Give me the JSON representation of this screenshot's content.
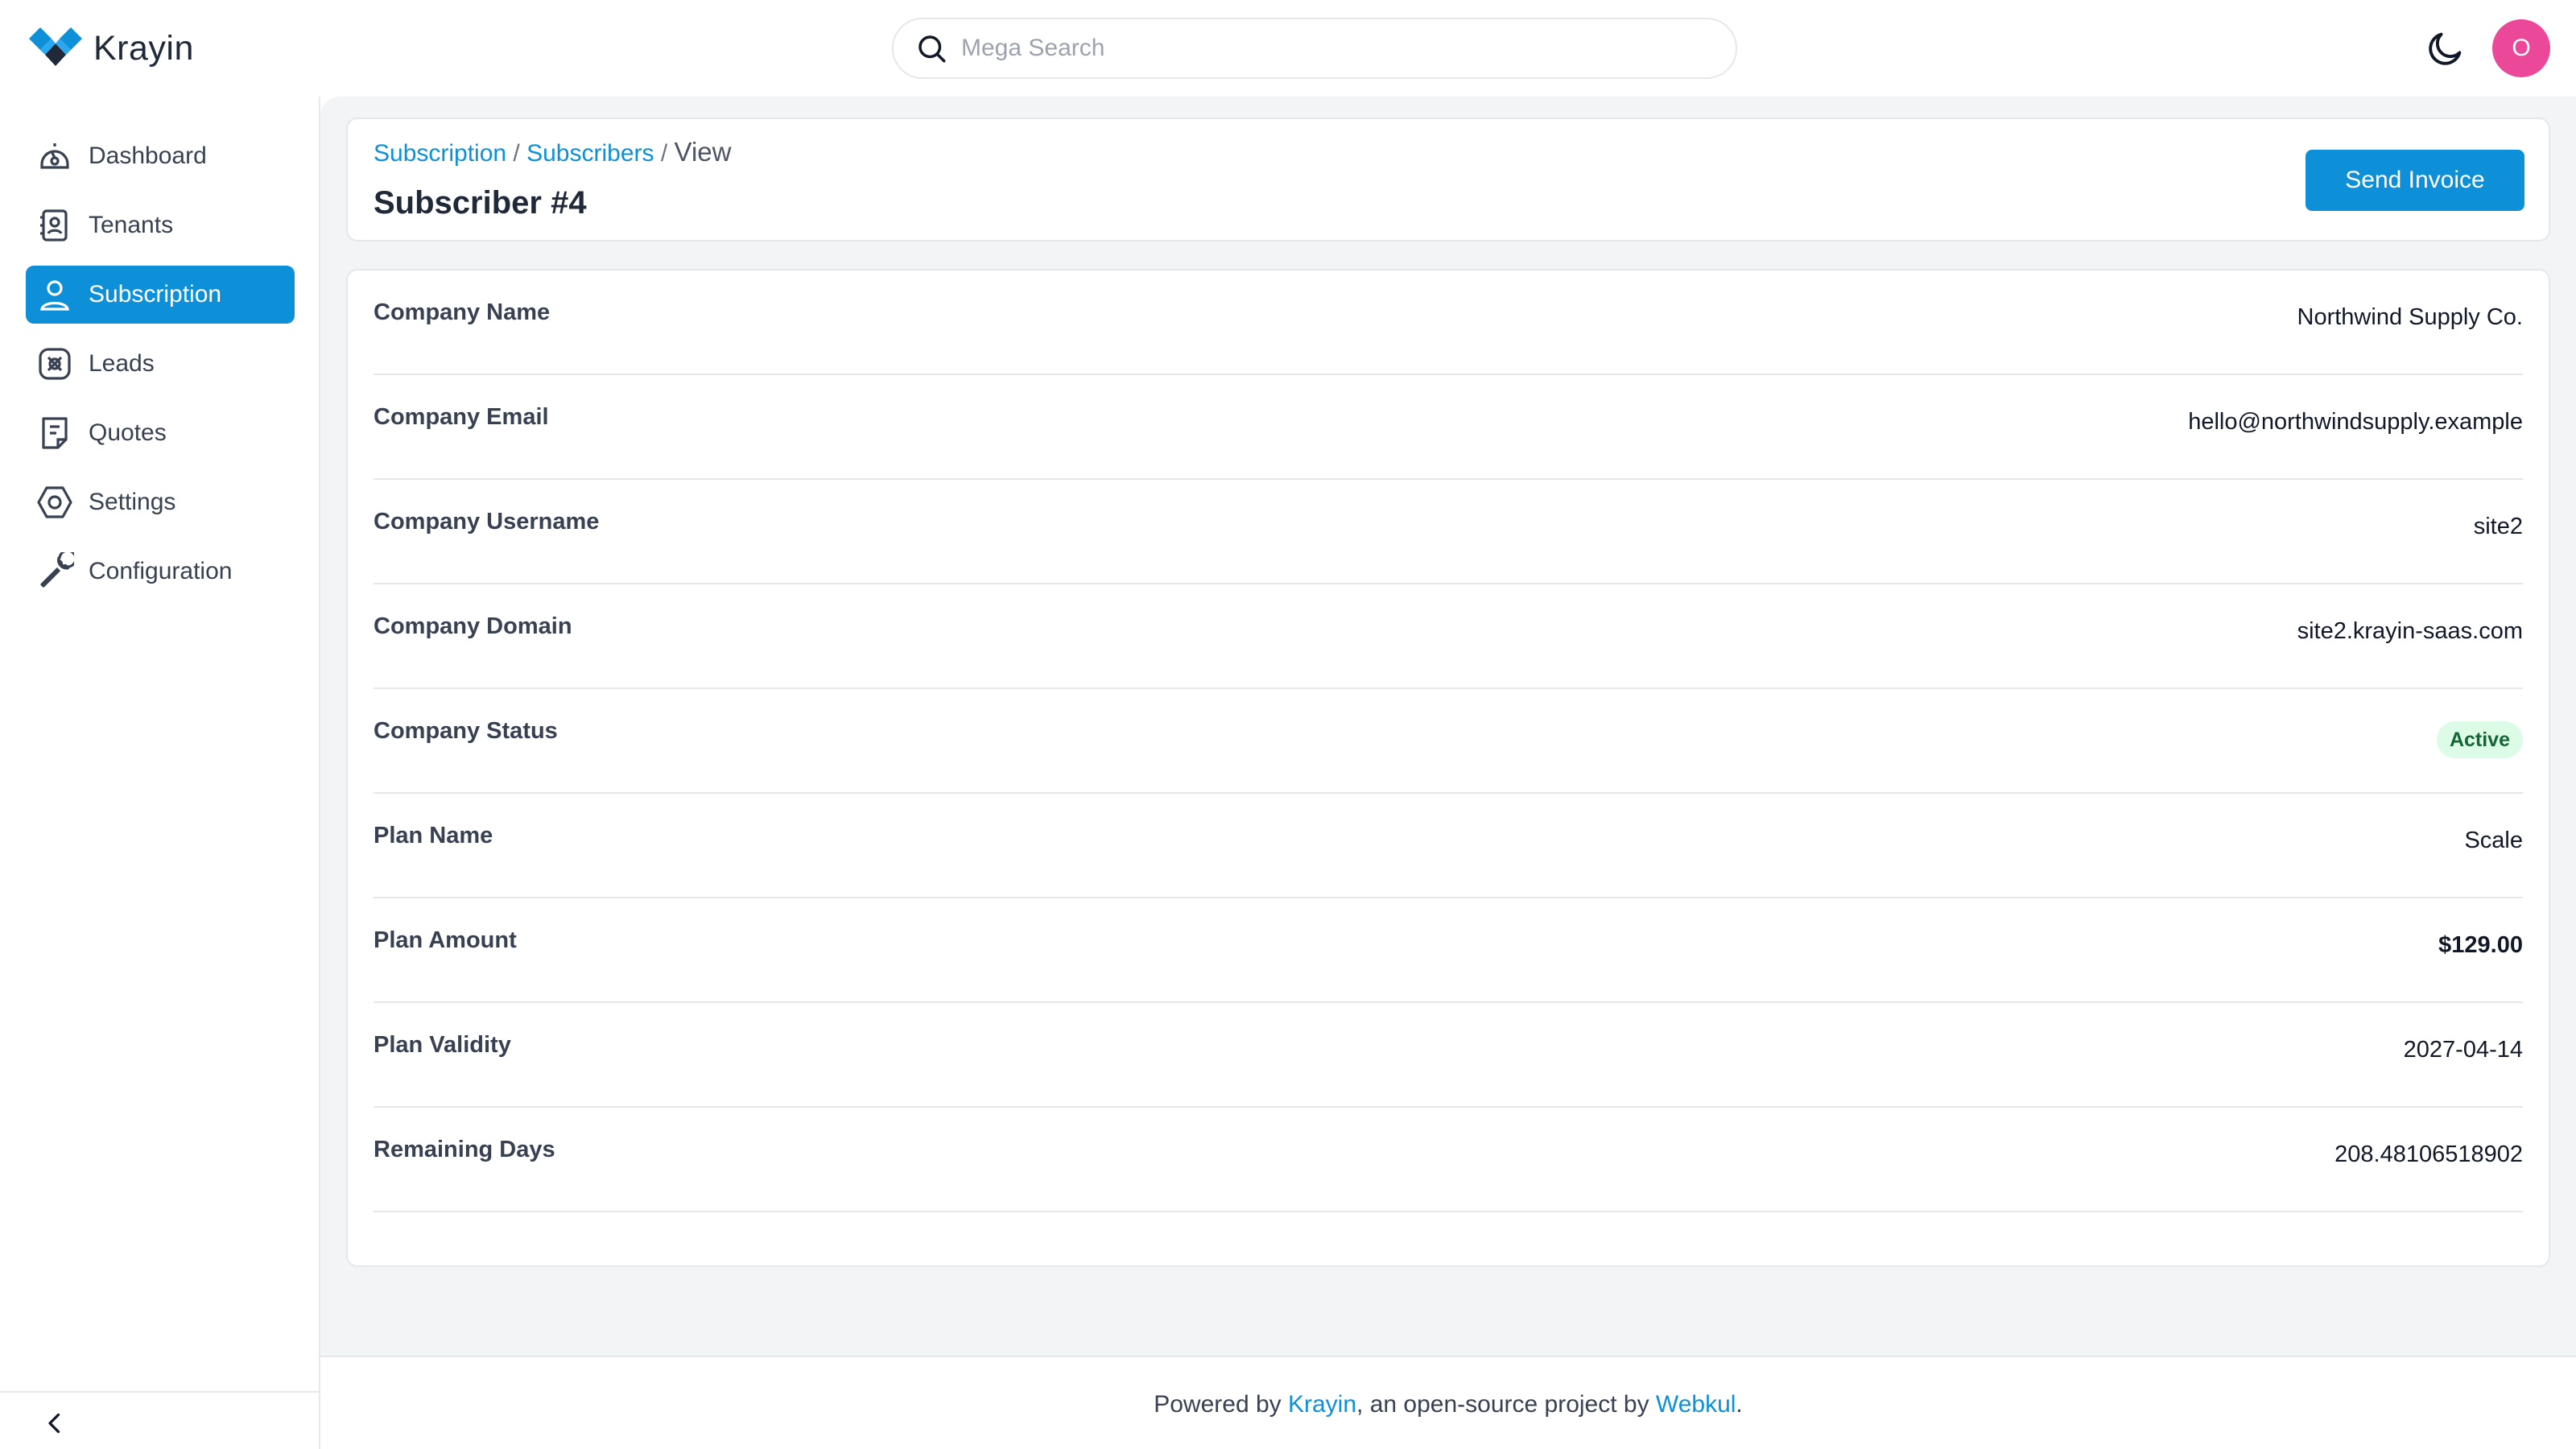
{
  "app": {
    "name": "Krayin"
  },
  "header": {
    "search_placeholder": "Mega Search",
    "avatar_initial": "O"
  },
  "sidebar": {
    "items": [
      {
        "label": "Dashboard",
        "icon": "dashboard-icon"
      },
      {
        "label": "Tenants",
        "icon": "tenants-icon"
      },
      {
        "label": "Subscription",
        "icon": "user-icon",
        "active": true
      },
      {
        "label": "Leads",
        "icon": "leads-icon"
      },
      {
        "label": "Quotes",
        "icon": "quotes-icon"
      },
      {
        "label": "Settings",
        "icon": "settings-icon"
      },
      {
        "label": "Configuration",
        "icon": "wrench-icon"
      }
    ]
  },
  "breadcrumb": {
    "item1": "Subscription",
    "sep1": " / ",
    "item2": "Subscribers",
    "sep2": " / ",
    "current": "View"
  },
  "page": {
    "title": "Subscriber #4",
    "send_invoice_label": "Send Invoice"
  },
  "details": {
    "company_name": {
      "label": "Company Name",
      "value": "Northwind Supply Co."
    },
    "company_email": {
      "label": "Company Email",
      "value": "hello@northwindsupply.example"
    },
    "company_username": {
      "label": "Company Username",
      "value": "site2"
    },
    "company_domain": {
      "label": "Company Domain",
      "value": "site2.krayin-saas.com"
    },
    "company_status": {
      "label": "Company Status",
      "value": "Active"
    },
    "plan_name": {
      "label": "Plan Name",
      "value": "Scale"
    },
    "plan_amount": {
      "label": "Plan Amount",
      "value": "$129.00"
    },
    "plan_validity": {
      "label": "Plan Validity",
      "value": "2027-04-14"
    },
    "remaining_days": {
      "label": "Remaining Days",
      "value": "208.48106518902"
    }
  },
  "footer": {
    "prefix": "Powered by ",
    "link1": "Krayin",
    "middle": ", an open-source project by ",
    "link2": "Webkul",
    "suffix": "."
  },
  "colors": {
    "accent": "#0e90d9",
    "avatar": "#ec4899",
    "badge_bg": "#dcfce7",
    "badge_text": "#166534"
  }
}
